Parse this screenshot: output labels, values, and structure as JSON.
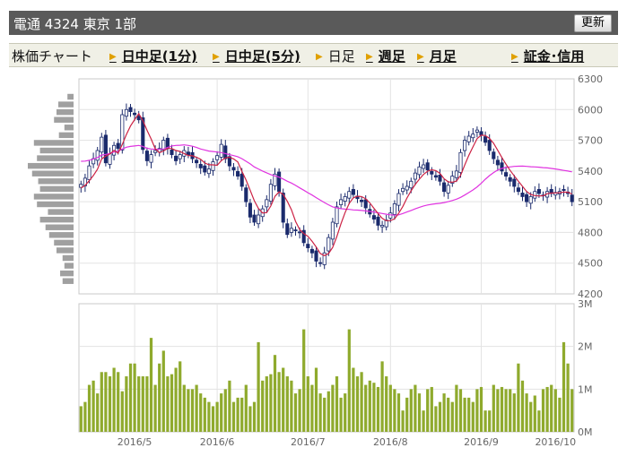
{
  "header": {
    "stock_title": "電通  4324  東京 1部",
    "refresh_label": "更新"
  },
  "nav": {
    "label": "株価チャート",
    "items": [
      {
        "label": "日中足(1分)",
        "active": false
      },
      {
        "label": "日中足(5分)",
        "active": false
      },
      {
        "label": "日足",
        "active": true
      },
      {
        "label": "週足",
        "active": false
      },
      {
        "label": "月足",
        "active": false
      },
      {
        "label": "証金･信用",
        "active": false
      }
    ]
  },
  "colors": {
    "up": "#ffffff",
    "down": "#1a2a6c",
    "ma_short": "#cc2244",
    "ma_long": "#e033e0",
    "volume": "#8faa2d",
    "profile": "#a0a0a0"
  },
  "chart_data": {
    "type": "candlestick",
    "price_axis": {
      "ticks": [
        "6300",
        "6000",
        "5700",
        "5400",
        "5100",
        "4800",
        "4500",
        "4200"
      ],
      "min": 4200,
      "max": 6300
    },
    "volume_axis": {
      "ticks": [
        "3M",
        "2M",
        "1M",
        "0M"
      ],
      "min": 0,
      "max": 3000000
    },
    "x_labels": [
      "2016/5",
      "2016/6",
      "2016/7",
      "2016/8",
      "2016/9",
      "2016/10"
    ],
    "x_label_positions": [
      13,
      33,
      55,
      75,
      97,
      115
    ],
    "closes": [
      5270,
      5330,
      5450,
      5520,
      5600,
      5730,
      5480,
      5570,
      5650,
      5620,
      5950,
      6000,
      5980,
      5950,
      5900,
      5610,
      5500,
      5560,
      5600,
      5620,
      5700,
      5620,
      5560,
      5500,
      5560,
      5600,
      5560,
      5520,
      5480,
      5430,
      5390,
      5420,
      5490,
      5550,
      5660,
      5520,
      5450,
      5410,
      5350,
      5250,
      5100,
      4950,
      4900,
      4970,
      5030,
      5120,
      5270,
      5370,
      5200,
      4900,
      4780,
      4840,
      4820,
      4800,
      4700,
      4650,
      4600,
      4520,
      4500,
      4600,
      4750,
      4900,
      5050,
      5120,
      5150,
      5200,
      5170,
      5130,
      5100,
      5040,
      4980,
      4930,
      4870,
      4870,
      4920,
      4990,
      5080,
      5180,
      5230,
      5250,
      5300,
      5380,
      5440,
      5460,
      5410,
      5370,
      5340,
      5300,
      5200,
      5260,
      5350,
      5400,
      5580,
      5700,
      5740,
      5760,
      5800,
      5750,
      5680,
      5600,
      5520,
      5460,
      5400,
      5350,
      5300,
      5250,
      5200,
      5150,
      5100,
      5150,
      5200,
      5180,
      5160,
      5200,
      5180,
      5190,
      5200,
      5210,
      5180,
      5100
    ],
    "volumes": [
      600000,
      700000,
      1100000,
      1200000,
      900000,
      1400000,
      1400000,
      1300000,
      1500000,
      1400000,
      950000,
      1300000,
      1600000,
      1600000,
      1300000,
      1300000,
      1300000,
      2200000,
      1100000,
      1600000,
      1900000,
      1300000,
      1350000,
      1500000,
      1650000,
      1100000,
      1000000,
      1000000,
      1100000,
      900000,
      800000,
      700000,
      600000,
      700000,
      900000,
      1000000,
      1200000,
      700000,
      800000,
      800000,
      1100000,
      600000,
      700000,
      2100000,
      1200000,
      1300000,
      1350000,
      1800000,
      1400000,
      1500000,
      1300000,
      1200000,
      900000,
      1000000,
      2400000,
      1300000,
      1100000,
      1500000,
      900000,
      800000,
      950000,
      1100000,
      1300000,
      800000,
      900000,
      2400000,
      1500000,
      1300000,
      1400000,
      1100000,
      1200000,
      1150000,
      1050000,
      1650000,
      1300000,
      1100000,
      1000000,
      900000,
      500000,
      800000,
      1000000,
      1100000,
      900000,
      500000,
      1000000,
      1050000,
      600000,
      700000,
      900000,
      800000,
      700000,
      1100000,
      1000000,
      800000,
      800000,
      700000,
      1000000,
      1050000,
      500000,
      500000,
      1100000,
      1000000,
      1050000,
      1000000,
      1000000,
      900000,
      1600000,
      1200000,
      900000,
      700000,
      850000,
      500000,
      1000000,
      1050000,
      1100000,
      1000000,
      800000,
      2100000,
      1600000,
      1000000
    ],
    "ma_short": [
      5233,
      5260,
      5305,
      5356,
      5418,
      5518,
      5546,
      5566,
      5602,
      5574,
      5659,
      5757,
      5840,
      5902,
      5960,
      5892,
      5798,
      5713,
      5617,
      5579,
      5596,
      5620,
      5620,
      5600,
      5591,
      5570,
      5552,
      5548,
      5534,
      5514,
      5478,
      5461,
      5460,
      5456,
      5501,
      5527,
      5534,
      5518,
      5488,
      5396,
      5312,
      5212,
      5110,
      5034,
      4990,
      4994,
      5058,
      5152,
      5196,
      5172,
      5104,
      5022,
      4908,
      4828,
      4788,
      4762,
      4714,
      4658,
      4594,
      4574,
      4594,
      4654,
      4760,
      4884,
      4994,
      5084,
      5138,
      5154,
      5150,
      5128,
      5088,
      5036,
      4984,
      4938,
      4914,
      4916,
      4932,
      4988,
      5054,
      5136,
      5206,
      5268,
      5320,
      5366,
      5398,
      5412,
      5404,
      5376,
      5324,
      5294,
      5290,
      5302,
      5358,
      5458,
      5554,
      5636,
      5716,
      5750,
      5746,
      5718,
      5670,
      5602,
      5532,
      5466,
      5406,
      5352,
      5300,
      5250,
      5200,
      5170,
      5160,
      5156,
      5158,
      5178,
      5184,
      5186,
      5188,
      5194,
      5192,
      5176
    ],
    "ma_long": [
      5495,
      5497,
      5505,
      5518,
      5532,
      5555,
      5562,
      5572,
      5585,
      5595,
      5615,
      5632,
      5640,
      5645,
      5650,
      5640,
      5622,
      5615,
      5612,
      5612,
      5615,
      5630,
      5645,
      5650,
      5652,
      5655,
      5650,
      5642,
      5630,
      5615,
      5605,
      5595,
      5590,
      5585,
      5580,
      5570,
      5560,
      5550,
      5540,
      5520,
      5495,
      5470,
      5440,
      5420,
      5400,
      5382,
      5365,
      5352,
      5340,
      5322,
      5300,
      5282,
      5260,
      5235,
      5212,
      5188,
      5165,
      5140,
      5115,
      5092,
      5070,
      5050,
      5040,
      5032,
      5028,
      5025,
      5020,
      5018,
      5015,
      5010,
      5005,
      5000,
      4992,
      4985,
      4978,
      4972,
      4968,
      4972,
      4985,
      5000,
      5015,
      5030,
      5045,
      5058,
      5068,
      5075,
      5080,
      5085,
      5092,
      5100,
      5112,
      5125,
      5142,
      5165,
      5190,
      5215,
      5245,
      5280,
      5320,
      5355,
      5385,
      5410,
      5425,
      5435,
      5440,
      5445,
      5447,
      5448,
      5445,
      5442,
      5440,
      5437,
      5433,
      5430,
      5425,
      5420,
      5413,
      5406,
      5400,
      5392
    ],
    "volume_profile": [
      {
        "price": 6125,
        "volume": 0.1
      },
      {
        "price": 6050,
        "volume": 0.25
      },
      {
        "price": 5975,
        "volume": 0.28
      },
      {
        "price": 5900,
        "volume": 0.32
      },
      {
        "price": 5825,
        "volume": 0.15
      },
      {
        "price": 5750,
        "volume": 0.24
      },
      {
        "price": 5675,
        "volume": 0.65
      },
      {
        "price": 5600,
        "volume": 0.55
      },
      {
        "price": 5525,
        "volume": 0.6
      },
      {
        "price": 5450,
        "volume": 0.75
      },
      {
        "price": 5375,
        "volume": 0.68
      },
      {
        "price": 5300,
        "volume": 0.58
      },
      {
        "price": 5225,
        "volume": 0.55
      },
      {
        "price": 5150,
        "volume": 0.65
      },
      {
        "price": 5075,
        "volume": 0.6
      },
      {
        "price": 5000,
        "volume": 0.42
      },
      {
        "price": 4925,
        "volume": 0.55
      },
      {
        "price": 4850,
        "volume": 0.46
      },
      {
        "price": 4775,
        "volume": 0.4
      },
      {
        "price": 4700,
        "volume": 0.32
      },
      {
        "price": 4625,
        "volume": 0.28
      },
      {
        "price": 4550,
        "volume": 0.18
      },
      {
        "price": 4475,
        "volume": 0.15
      },
      {
        "price": 4400,
        "volume": 0.22
      },
      {
        "price": 4325,
        "volume": 0.18
      }
    ]
  }
}
